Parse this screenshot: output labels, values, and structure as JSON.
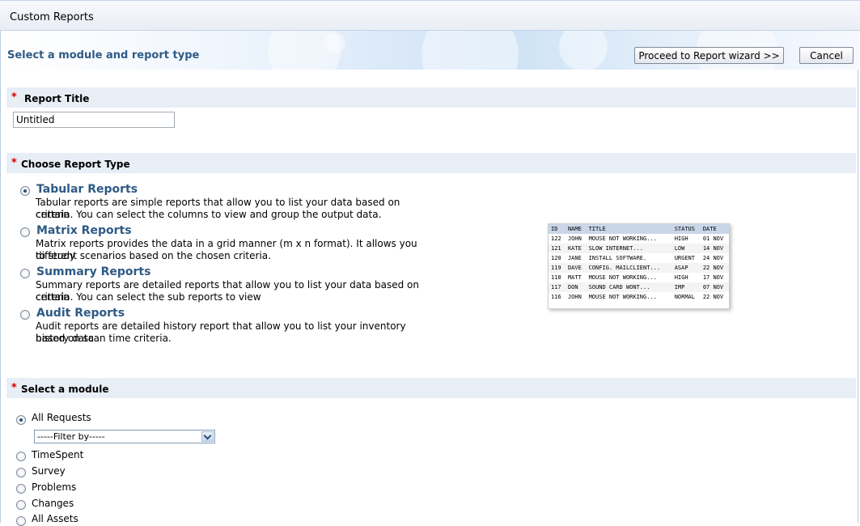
{
  "window": {
    "title": "Custom Reports"
  },
  "banner": {
    "heading": "Select a module and report type",
    "proceed_label": "Proceed to Report wizard >>",
    "cancel_label": "Cancel"
  },
  "report_title": {
    "label": "Report Title",
    "value": "Untitled"
  },
  "report_type": {
    "label": "Choose Report Type",
    "selected": "Tabular Reports",
    "options": [
      {
        "title": "Tabular Reports",
        "desc1": "Tabular reports are simple reports that allow you to list your data based on certain",
        "desc2": "criteria. You can select the columns to view and group the output data."
      },
      {
        "title": "Matrix Reports",
        "desc1": "Matrix reports provides the data in a grid manner (m x n format). It allows you to study",
        "desc2": "different scenarios based on the chosen criteria."
      },
      {
        "title": "Summary Reports",
        "desc1": "Summary reports are detailed reports that allow you to list your data based on certain",
        "desc2": "criteria. You can select the sub reports to view"
      },
      {
        "title": "Audit Reports",
        "desc1": "Audit reports are detailed history report that allow you to list your inventory history data",
        "desc2": "based on scan time criteria."
      }
    ]
  },
  "preview": {
    "headers": [
      "ID",
      "NAME",
      "TITLE",
      "STATUS",
      "DATE"
    ],
    "rows": [
      [
        "122",
        "JOHN",
        "MOUSE NOT WORKING...",
        "HIGH",
        "01 NOV"
      ],
      [
        "121",
        "KATE",
        "SLOW INTERNET...",
        "LOW",
        "14 NOV"
      ],
      [
        "120",
        "JANE",
        "INSTALL SOFTWARE.",
        "URGENT",
        "24 NOV"
      ],
      [
        "119",
        "DAVE",
        "CONFIG. MAILCLIENT...",
        "ASAP",
        "22 NOV"
      ],
      [
        "118",
        "MATT",
        "MOUSE NOT WORKING...",
        "HIGH",
        "17 NOV"
      ],
      [
        "117",
        "DON",
        "SOUND CARD WONT...",
        "IMP",
        "07 NOV"
      ],
      [
        "116",
        "JOHN",
        "MOUSE NOT WORKING...",
        "NORMAL",
        "22 NOV"
      ]
    ]
  },
  "module": {
    "label": "Select a module",
    "selected": "All Requests",
    "filter_value": "-----Filter by-----",
    "options": [
      "All Requests",
      "TimeSpent",
      "Survey",
      "Problems",
      "Changes",
      "All Assets"
    ]
  }
}
